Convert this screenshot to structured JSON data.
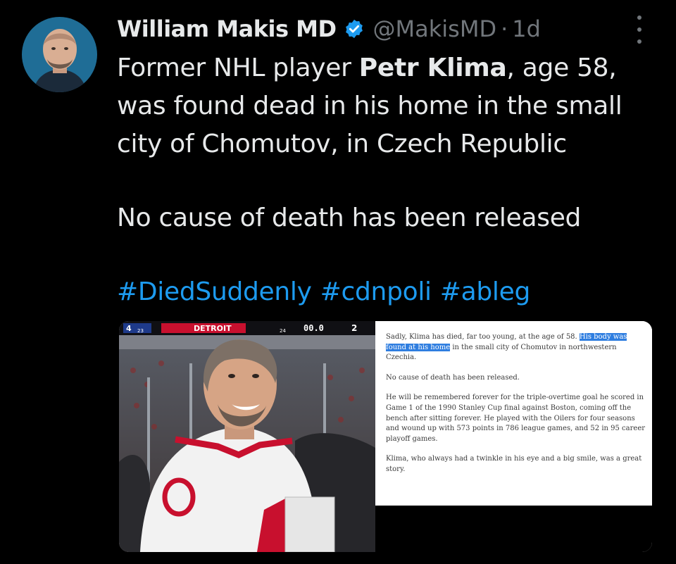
{
  "tweet": {
    "display_name": "William Makis MD",
    "handle": "@MakisMD",
    "separator": "·",
    "time": "1d",
    "body": {
      "line1_a": "Former NHL player ",
      "line1_b": "Petr Klima",
      "line1_c": ", age 58,",
      "line2": "was found dead in his home in the small",
      "line3": "city of Chomutov, in Czech Republic",
      "line4": "No cause of death has been released"
    },
    "hashtags": [
      "#DiedSuddenly",
      "#cdnpoli",
      "#ableg"
    ]
  },
  "media": {
    "scoreboard": {
      "left": "4",
      "left_small": "23",
      "team": "DETROIT",
      "period_small": "24",
      "clock": "00.0",
      "period": "2"
    },
    "article": {
      "p1_a": "Sadly, Klima has died, far too young, at the age of 58. ",
      "p1_hl": "His body was found at his home",
      "p1_b": " in the small city of Chomutov in northwestern Czechia.",
      "p2": "No cause of death has been released.",
      "p3": "He will be remembered forever for the triple-overtime goal he scored in Game 1 of the 1990 Stanley Cup final against Boston, coming off the bench after sitting forever. He played with the Oilers for four seasons and wound up with 573 points in 786 league games, and 52 in 95 career playoff games.",
      "p4": "Klima, who always had a twinkle in his eye and a big smile, was a great story."
    }
  },
  "colors": {
    "background": "#000000",
    "text": "#e7e9ea",
    "muted": "#71767b",
    "link": "#1d9bf0",
    "verified": "#1d9bf0",
    "highlight": "#2f7ee0"
  }
}
